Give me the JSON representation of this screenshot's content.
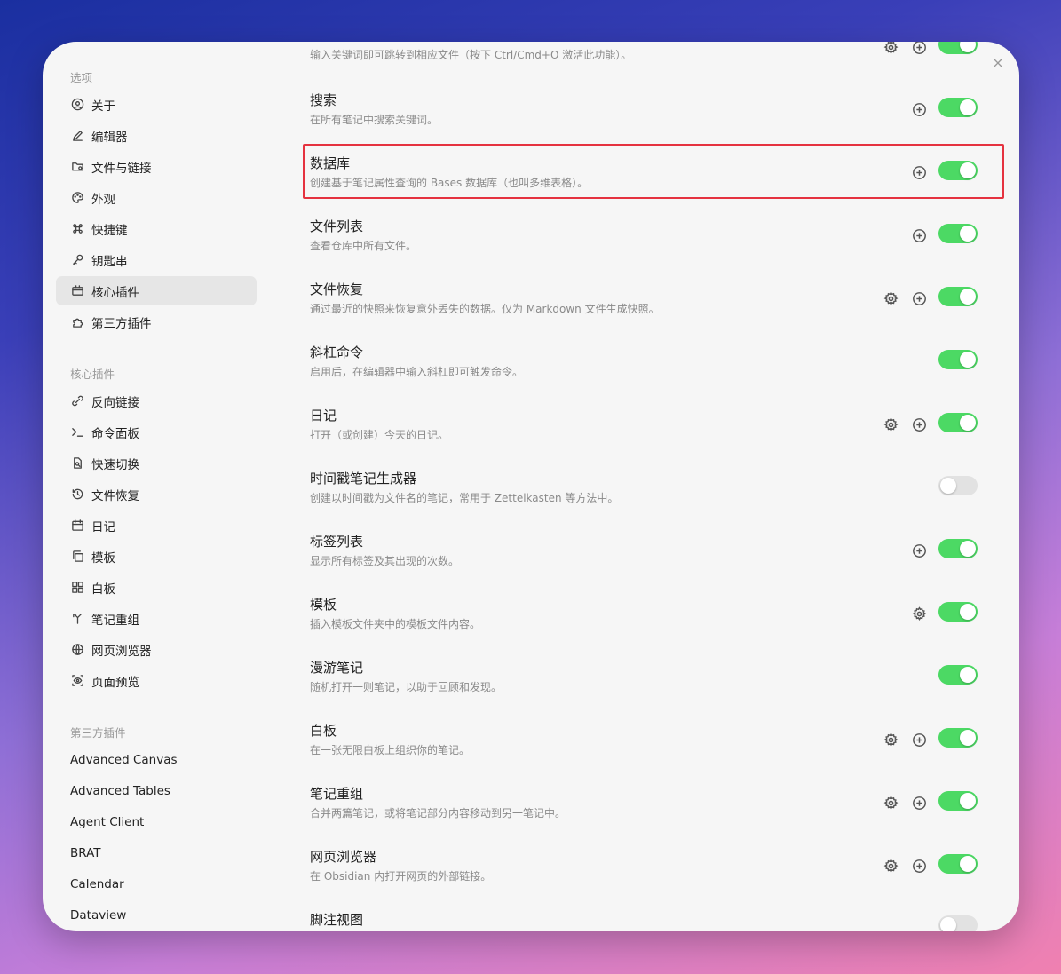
{
  "sidebar": {
    "options_title": "选项",
    "options": [
      {
        "label": "关于",
        "icon": "about-icon"
      },
      {
        "label": "编辑器",
        "icon": "pen-icon"
      },
      {
        "label": "文件与链接",
        "icon": "folder-link-icon"
      },
      {
        "label": "外观",
        "icon": "palette-icon"
      },
      {
        "label": "快捷键",
        "icon": "command-icon"
      },
      {
        "label": "钥匙串",
        "icon": "key-icon"
      },
      {
        "label": "核心插件",
        "icon": "plugin-box-icon",
        "active": true
      },
      {
        "label": "第三方插件",
        "icon": "puzzle-icon"
      }
    ],
    "core_title": "核心插件",
    "core": [
      {
        "label": "反向链接",
        "icon": "backlink-icon"
      },
      {
        "label": "命令面板",
        "icon": "terminal-icon"
      },
      {
        "label": "快速切换",
        "icon": "file-search-icon"
      },
      {
        "label": "文件恢复",
        "icon": "history-icon"
      },
      {
        "label": "日记",
        "icon": "calendar-icon"
      },
      {
        "label": "模板",
        "icon": "copy-icon"
      },
      {
        "label": "白板",
        "icon": "grid-icon"
      },
      {
        "label": "笔记重组",
        "icon": "merge-icon"
      },
      {
        "label": "网页浏览器",
        "icon": "globe-icon"
      },
      {
        "label": "页面预览",
        "icon": "preview-eye-icon"
      }
    ],
    "third_title": "第三方插件",
    "third": [
      "Advanced Canvas",
      "Advanced Tables",
      "Agent Client",
      "BRAT",
      "Calendar",
      "Dataview"
    ]
  },
  "close_icon": "×",
  "plugins": [
    {
      "title": "",
      "desc": "输入关键词即可跳转到相应文件（按下 Ctrl/Cmd+O 激活此功能）。",
      "gear": true,
      "plus": true,
      "on": true
    },
    {
      "title": "搜索",
      "desc": "在所有笔记中搜索关键词。",
      "gear": false,
      "plus": true,
      "on": true
    },
    {
      "title": "数据库",
      "desc": "创建基于笔记属性查询的 Bases 数据库（也叫多维表格）。",
      "gear": false,
      "plus": true,
      "on": true
    },
    {
      "title": "文件列表",
      "desc": "查看仓库中所有文件。",
      "gear": false,
      "plus": true,
      "on": true
    },
    {
      "title": "文件恢复",
      "desc": "通过最近的快照来恢复意外丢失的数据。仅为 Markdown 文件生成快照。",
      "gear": true,
      "plus": true,
      "on": true
    },
    {
      "title": "斜杠命令",
      "desc": "启用后，在编辑器中输入斜杠即可触发命令。",
      "gear": false,
      "plus": false,
      "on": true
    },
    {
      "title": "日记",
      "desc": "打开（或创建）今天的日记。",
      "gear": true,
      "plus": true,
      "on": true
    },
    {
      "title": "时间戳笔记生成器",
      "desc": "创建以时间戳为文件名的笔记，常用于 Zettelkasten 等方法中。",
      "gear": false,
      "plus": false,
      "on": false
    },
    {
      "title": "标签列表",
      "desc": "显示所有标签及其出现的次数。",
      "gear": false,
      "plus": true,
      "on": true
    },
    {
      "title": "模板",
      "desc": "插入模板文件夹中的模板文件内容。",
      "gear": true,
      "gear_only": true,
      "plus": false,
      "on": true
    },
    {
      "title": "漫游笔记",
      "desc": "随机打开一则笔记，以助于回顾和发现。",
      "gear": false,
      "plus": false,
      "on": true
    },
    {
      "title": "白板",
      "desc": "在一张无限白板上组织你的笔记。",
      "gear": true,
      "plus": true,
      "on": true
    },
    {
      "title": "笔记重组",
      "desc": "合并两篇笔记，或将笔记部分内容移动到另一笔记中。",
      "gear": true,
      "plus": true,
      "on": true
    },
    {
      "title": "网页浏览器",
      "desc": "在 Obsidian 内打开网页的外部链接。",
      "gear": true,
      "plus": true,
      "on": true
    },
    {
      "title": "脚注视图",
      "desc": "",
      "gear": false,
      "plus": false,
      "on": false
    }
  ]
}
